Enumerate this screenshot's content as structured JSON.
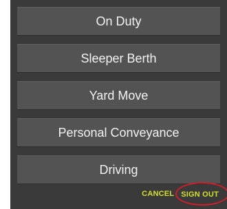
{
  "dialog": {
    "options": [
      {
        "label": "On Duty"
      },
      {
        "label": "Sleeper Berth"
      },
      {
        "label": "Yard Move"
      },
      {
        "label": "Personal Conveyance"
      },
      {
        "label": "Driving"
      }
    ],
    "actions": {
      "cancel_label": "CANCEL",
      "sign_out_label": "SIGN OUT"
    },
    "colors": {
      "dialog_background": "#3a3a3a",
      "option_background": "#535353",
      "action_text": "#d5df2f",
      "highlight_annotation": "#d21e2b"
    }
  }
}
